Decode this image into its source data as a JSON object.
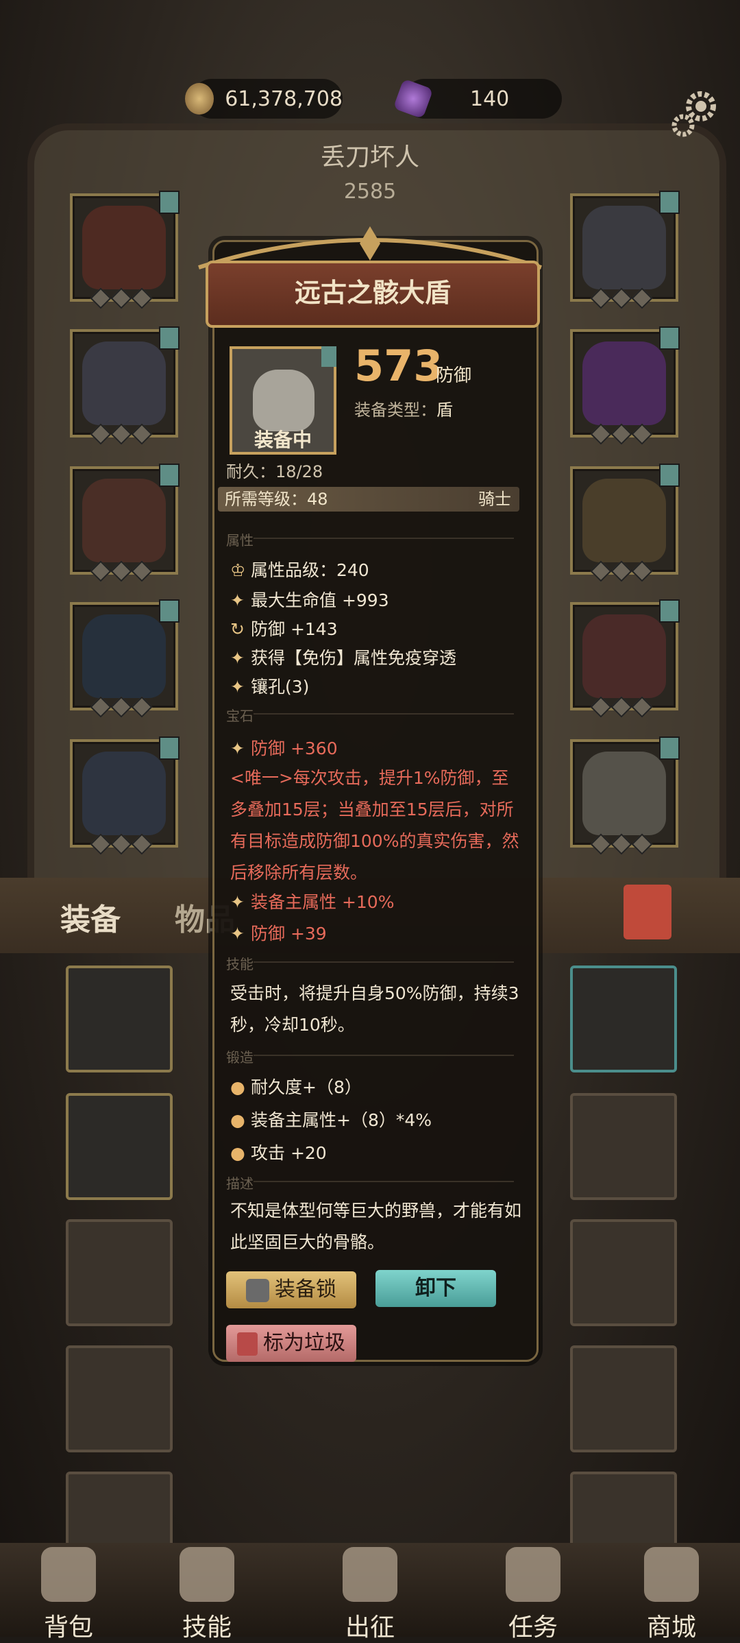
{
  "currency": {
    "gold": "61,378,708",
    "gems": "140"
  },
  "player": {
    "name": "丢刀坏人",
    "score": "2585"
  },
  "tooltip": {
    "title": "远古之骸大盾",
    "status": "装备中",
    "defense_value": "573",
    "defense_unit": "防御",
    "equip_type_label": "装备类型：",
    "equip_type": "盾",
    "durability": "耐久：18/28",
    "req_level": "所需等级：48",
    "req_class": "骑士",
    "section_attr": "属性",
    "attr_grade": "属性品级：240",
    "attr_hp": "最大生命值 +993",
    "attr_def": "防御 +143",
    "attr_immune": "获得【免伤】属性免疫穿透",
    "attr_socket": "镶孔(3)",
    "section_gem": "宝石",
    "gem_def": "防御 +360",
    "unique_text": "<唯一>每次攻击，提升1%防御，至多叠加15层；当叠加至15层后，对所有目标造成防御100%的真实伤害，然后移除所有层数。",
    "gem_main": "装备主属性 +10%",
    "gem_def2": "防御 +39",
    "section_skill": "技能",
    "skill_text": "受击时，将提升自身50%防御，持续3秒，冷却10秒。",
    "section_forge": "锻造",
    "forge_dur": "耐久度+（8）",
    "forge_main": "装备主属性+（8）*4%",
    "forge_atk": "攻击 +20",
    "section_desc": "描述",
    "desc_text": "不知是体型何等巨大的野兽，才能有如此坚固巨大的骨骼。",
    "lock_label": "装备锁",
    "unequip_label": "卸下",
    "junk_label": "标为垃圾"
  },
  "tabs": {
    "equip": "装备",
    "items": "物品"
  },
  "nav": [
    "背包",
    "技能",
    "出征",
    "任务",
    "商城"
  ],
  "colors": {
    "accent_gold": "#c7a15e",
    "red_text": "#e66a5a",
    "teal_button": "#5fb7b0"
  }
}
